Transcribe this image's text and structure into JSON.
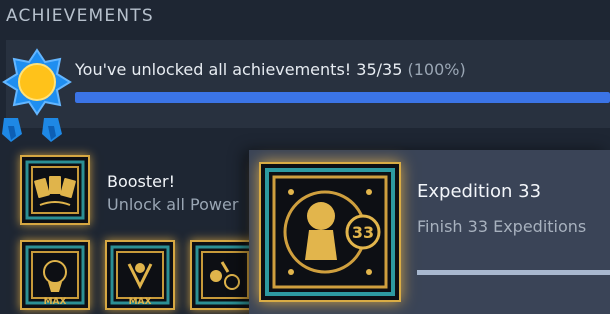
{
  "section": {
    "title": "ACHIEVEMENTS"
  },
  "summary": {
    "text": "You've unlocked all achievements! 35/35",
    "percent_text": "(100%)",
    "progress": 1.0,
    "progress_color": "#3b74e6",
    "badge_icon": "sun-medal-icon"
  },
  "achievements": [
    {
      "title": "Booster!",
      "description": "Unlock all Power",
      "icon": "booster-cards-icon",
      "unlocked": true
    },
    {
      "icon": "max-trophy-icon",
      "badge": "MAX",
      "unlocked": true
    },
    {
      "icon": "max-trophy-icon",
      "badge": "MAX",
      "unlocked": true
    },
    {
      "icon": "creatures-icon",
      "unlocked": true
    }
  ],
  "popup": {
    "title": "Expedition 33",
    "description": "Finish 33 Expeditions",
    "icon": "expedition-33-icon",
    "icon_number": "33",
    "progress": 1.0
  },
  "colors": {
    "background": "#1e2633",
    "panel": "#28313f",
    "gold": "#d6a742",
    "popup_bg": "#3a4457"
  }
}
